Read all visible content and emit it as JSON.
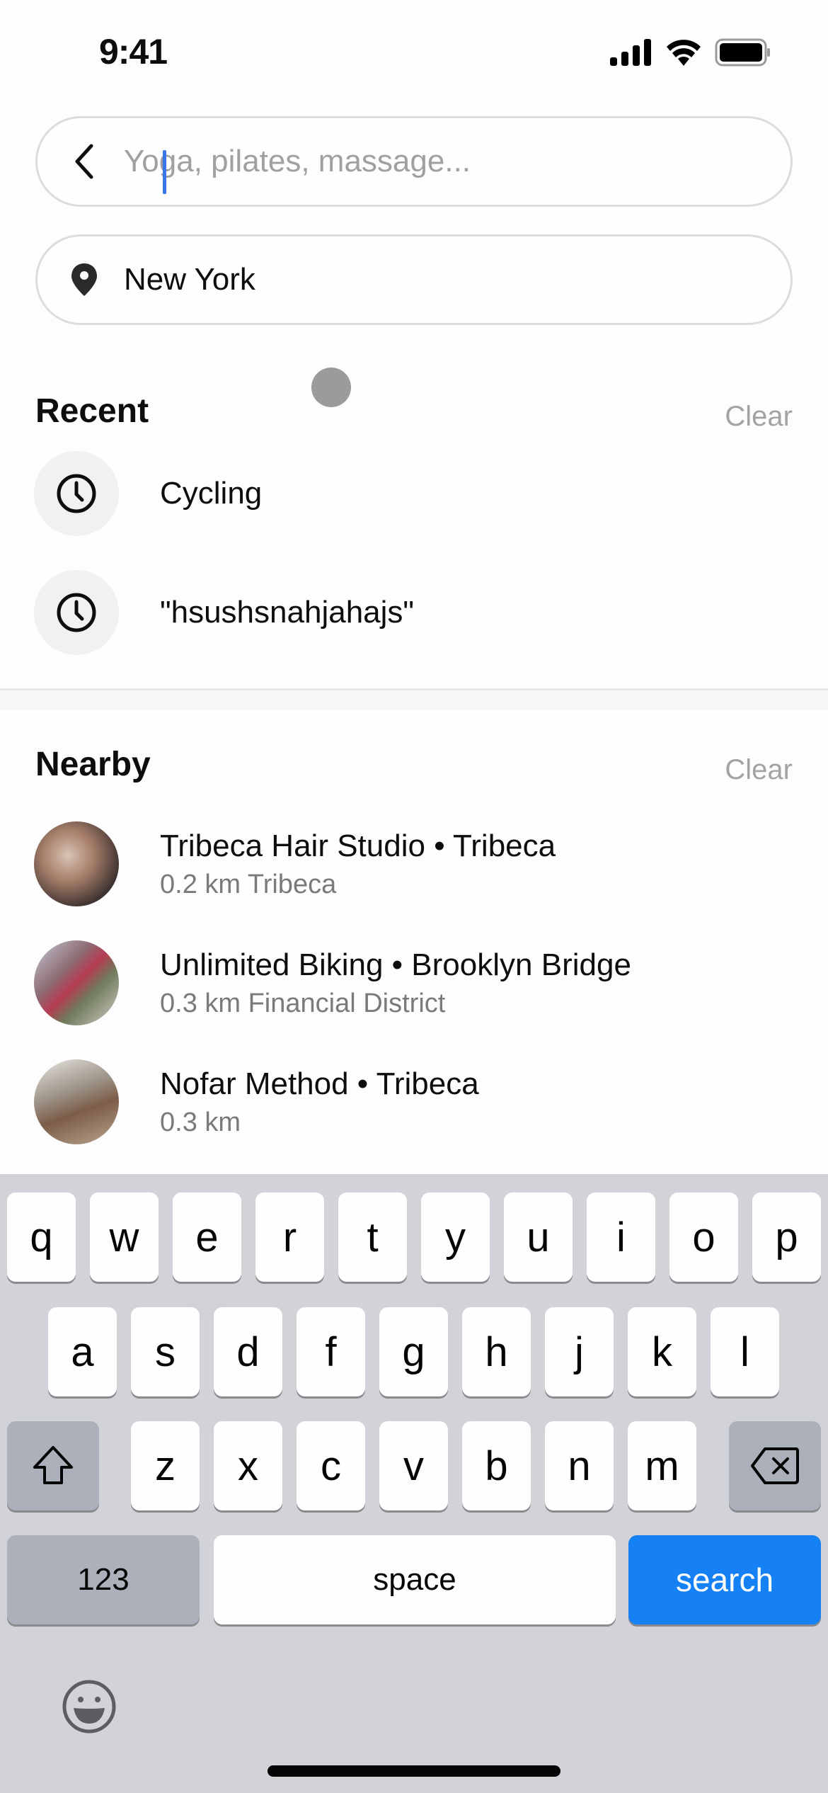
{
  "status_bar": {
    "time": "9:41",
    "icons": [
      "cellular-signal-icon",
      "wifi-icon",
      "battery-icon"
    ]
  },
  "search": {
    "back_icon": "chevron-left-icon",
    "placeholder": "Yoga, pilates, massage...",
    "value": ""
  },
  "location": {
    "icon": "location-pin-icon",
    "value": "New York"
  },
  "recent": {
    "title": "Recent",
    "clear_label": "Clear",
    "items": [
      {
        "icon": "clock-icon",
        "label": "Cycling"
      },
      {
        "icon": "clock-icon",
        "label": "\"hsushsnahjahajs\""
      }
    ]
  },
  "nearby": {
    "title": "Nearby",
    "clear_label": "Clear",
    "items": [
      {
        "title": "Tribeca Hair Studio • Tribeca",
        "subtitle": "0.2 km Tribeca"
      },
      {
        "title": "Unlimited Biking • Brooklyn Bridge",
        "subtitle": "0.3 km Financial District"
      },
      {
        "title": "Nofar Method • Tribeca",
        "subtitle": "0.3 km"
      }
    ]
  },
  "keyboard": {
    "row1": [
      "q",
      "w",
      "e",
      "r",
      "t",
      "y",
      "u",
      "i",
      "o",
      "p"
    ],
    "row2": [
      "a",
      "s",
      "d",
      "f",
      "g",
      "h",
      "j",
      "k",
      "l"
    ],
    "row3": [
      "z",
      "x",
      "c",
      "v",
      "b",
      "n",
      "m"
    ],
    "numbers_label": "123",
    "space_label": "space",
    "search_label": "search",
    "accent_color": "#1681f5"
  }
}
